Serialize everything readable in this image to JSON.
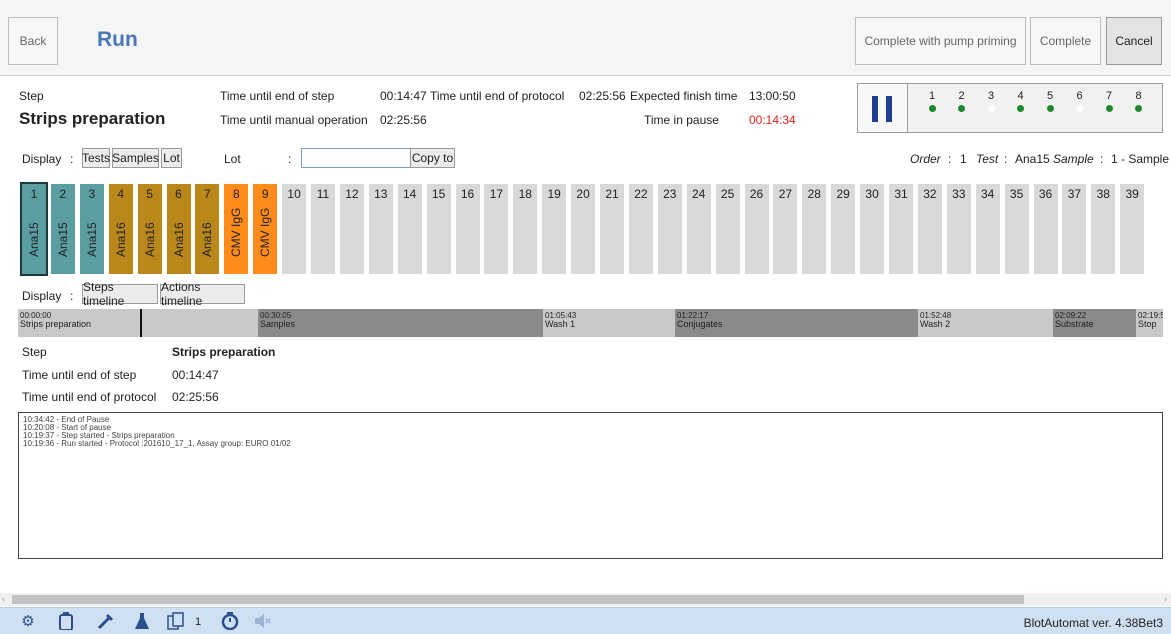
{
  "header": {
    "back_label": "Back",
    "title": "Run",
    "complete_priming_label": "Complete with pump priming",
    "complete_label": "Complete",
    "cancel_label": "Cancel"
  },
  "status": {
    "step_label": "Step",
    "step_value": "Strips preparation",
    "time_end_step_label": "Time until end of step",
    "time_end_step_value": "00:14:47",
    "time_end_protocol_label": "Time until end of protocol",
    "time_end_protocol_value": "02:25:56",
    "expected_finish_label": "Expected finish time",
    "expected_finish_value": "13:00:50",
    "time_manual_label": "Time until manual operation",
    "time_manual_value": "02:25:56",
    "time_pause_label": "Time in pause",
    "time_pause_value": "00:14:34"
  },
  "stations": [
    {
      "label": "1",
      "active": true
    },
    {
      "label": "2",
      "active": true
    },
    {
      "label": "3",
      "active": false
    },
    {
      "label": "4",
      "active": true
    },
    {
      "label": "5",
      "active": true
    },
    {
      "label": "6",
      "active": false
    },
    {
      "label": "7",
      "active": true
    },
    {
      "label": "8",
      "active": true
    }
  ],
  "display_bar": {
    "display_label": "Display",
    "colon": ":",
    "tests_label": "Tests",
    "samples_label": "Samples",
    "lot_btn_label": "Lot",
    "lot_label": "Lot",
    "lot_colon": ":",
    "lot_value": "",
    "copy_to_label": "Copy to",
    "order_label": "Order",
    "order_colon": ":",
    "order_value": "1",
    "test_label": "Test",
    "test_colon": ":",
    "test_value": "Ana15",
    "sample_label": "Sample",
    "sample_colon": ":",
    "sample_value": "1 - Sample"
  },
  "strips": [
    {
      "num": "1",
      "name": "Ana15",
      "color": "#5a9ea2"
    },
    {
      "num": "2",
      "name": "Ana15",
      "color": "#5a9ea2"
    },
    {
      "num": "3",
      "name": "Ana15",
      "color": "#5a9ea2"
    },
    {
      "num": "4",
      "name": "Ana16",
      "color": "#b9871a"
    },
    {
      "num": "5",
      "name": "Ana16",
      "color": "#b9871a"
    },
    {
      "num": "6",
      "name": "Ana16",
      "color": "#b9871a"
    },
    {
      "num": "7",
      "name": "Ana16",
      "color": "#b9871a"
    },
    {
      "num": "8",
      "name": "CMV IgG",
      "color": "#ff8c1a"
    },
    {
      "num": "9",
      "name": "CMV IgG",
      "color": "#ff8c1a"
    },
    {
      "num": "10",
      "name": ""
    },
    {
      "num": "11",
      "name": ""
    },
    {
      "num": "12",
      "name": ""
    },
    {
      "num": "13",
      "name": ""
    },
    {
      "num": "14",
      "name": ""
    },
    {
      "num": "15",
      "name": ""
    },
    {
      "num": "16",
      "name": ""
    },
    {
      "num": "17",
      "name": ""
    },
    {
      "num": "18",
      "name": ""
    },
    {
      "num": "19",
      "name": ""
    },
    {
      "num": "20",
      "name": ""
    },
    {
      "num": "21",
      "name": ""
    },
    {
      "num": "22",
      "name": ""
    },
    {
      "num": "23",
      "name": ""
    },
    {
      "num": "24",
      "name": ""
    },
    {
      "num": "25",
      "name": ""
    },
    {
      "num": "26",
      "name": ""
    },
    {
      "num": "27",
      "name": ""
    },
    {
      "num": "28",
      "name": ""
    },
    {
      "num": "29",
      "name": ""
    },
    {
      "num": "30",
      "name": ""
    },
    {
      "num": "31",
      "name": ""
    },
    {
      "num": "32",
      "name": ""
    },
    {
      "num": "33",
      "name": ""
    },
    {
      "num": "34",
      "name": ""
    },
    {
      "num": "35",
      "name": ""
    },
    {
      "num": "36",
      "name": ""
    },
    {
      "num": "37",
      "name": ""
    },
    {
      "num": "38",
      "name": ""
    },
    {
      "num": "39",
      "name": ""
    }
  ],
  "display2": {
    "display_label": "Display",
    "colon": ":",
    "steps_timeline_label": "Steps timeline",
    "actions_timeline_label": "Actions timeline"
  },
  "timeline": [
    {
      "time": "00:00:00",
      "name": "Strips preparation",
      "shade": "light"
    },
    {
      "time": "00:30:05",
      "name": "Samples",
      "shade": "dark"
    },
    {
      "time": "01:05:43",
      "name": "Wash 1",
      "shade": "light"
    },
    {
      "time": "01:22:17",
      "name": "Conjugates",
      "shade": "dark"
    },
    {
      "time": "01:52:48",
      "name": "Wash 2",
      "shade": "light"
    },
    {
      "time": "02:09:22",
      "name": "Substrate",
      "shade": "dark"
    },
    {
      "time": "02:19:5",
      "name": "Stop",
      "shade": "light"
    }
  ],
  "details": {
    "step_label": "Step",
    "step_value": "Strips preparation",
    "end_step_label": "Time until end of step",
    "end_step_value": "00:14:47",
    "end_protocol_label": "Time until end of protocol",
    "end_protocol_value": "02:25:56"
  },
  "log": [
    "10:34:42 - End of Pause",
    "10:20:08 - Start of pause",
    "10:19:37 - Step started - Strips preparation",
    "10:19:36 - Run started - Protocol :201610_17_1, Assay group: EURO 01/02"
  ],
  "bottombar": {
    "copy_count": "1",
    "version": "BlotAutomat ver. 4.38Bet3",
    "icons": [
      "gear-icon",
      "bottle-icon",
      "pipette-icon",
      "flask-icon",
      "copy-pages-icon",
      "timer-icon",
      "mute-icon"
    ]
  }
}
